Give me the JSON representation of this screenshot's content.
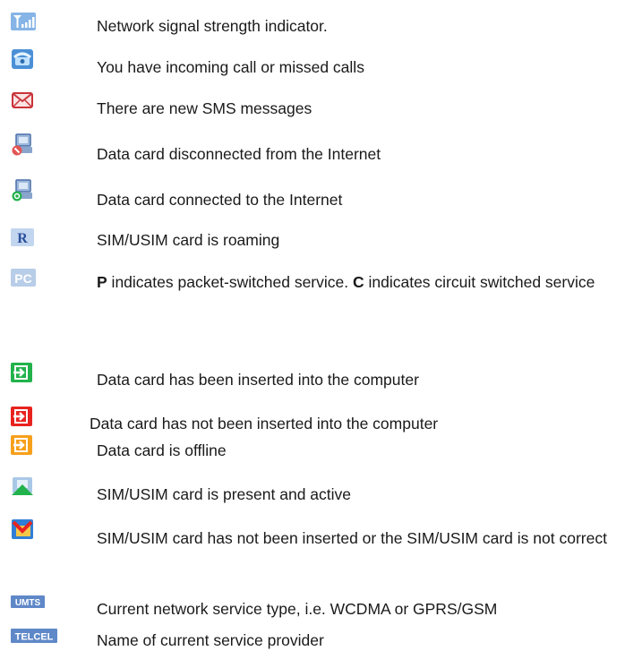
{
  "items": [
    {
      "icon": "signal-strength-icon",
      "text": "Network signal strength indicator."
    },
    {
      "icon": "incoming-call-icon",
      "text": "You have incoming call or missed calls"
    },
    {
      "icon": "new-sms-icon",
      "text": "There are new SMS messages"
    },
    {
      "icon": "disconnected-icon",
      "text": "Data card disconnected from the Internet"
    },
    {
      "icon": "connected-icon",
      "text": "Data card connected to the Internet"
    },
    {
      "icon": "roaming-icon",
      "icon_text": "R",
      "text": "SIM/USIM card is roaming"
    },
    {
      "icon": "packet-circuit-icon",
      "icon_text": "PC",
      "text_bold1": "P",
      "text_mid": " indicates packet-switched service. ",
      "text_bold2": "C",
      "text_end": " indicates circuit switched service"
    },
    {
      "icon": "card-inserted-icon",
      "text": "Data card has been inserted into the computer"
    },
    {
      "icon": "card-not-inserted-icon",
      "text": "Data card has not been inserted into the computer"
    },
    {
      "icon": "card-offline-icon",
      "text": "Data card is offline"
    },
    {
      "icon": "sim-active-icon",
      "text": "SIM/USIM card is present and active"
    },
    {
      "icon": "sim-missing-icon",
      "text": "SIM/USIM card has not been inserted or the SIM/USIM card is not correct"
    },
    {
      "icon": "network-type-icon",
      "icon_text": "UMTS",
      "text": "Current network service type, i.e. WCDMA or GPRS/GSM"
    },
    {
      "icon": "provider-icon",
      "icon_text": "TELCEL",
      "text": "Name of current service provider"
    }
  ],
  "colors": {
    "green": "#22b24c",
    "red": "#e8231f",
    "orange": "#f7a01c",
    "blue_badge": "#5f88c8",
    "text": "#1a1a1a"
  }
}
